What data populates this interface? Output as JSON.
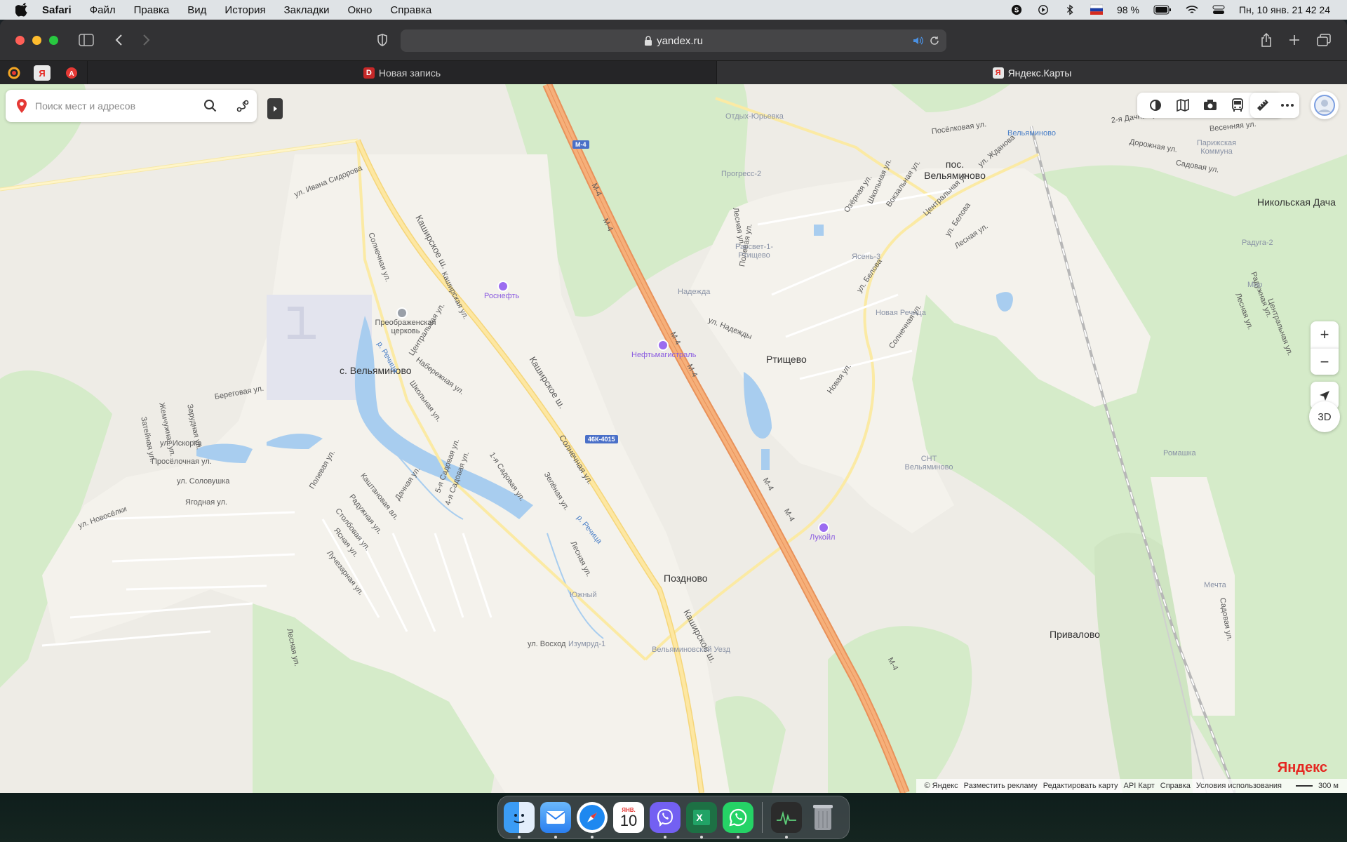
{
  "menubar": {
    "app": "Safari",
    "items": [
      "Файл",
      "Правка",
      "Вид",
      "История",
      "Закладки",
      "Окно",
      "Справка"
    ],
    "battery": "98 %",
    "datetime": "Пн, 10 янв. 21 42 24"
  },
  "browser": {
    "url": "yandex.ru",
    "tabs": [
      {
        "title": "Новая запись",
        "active": false
      },
      {
        "title": "Яндекс.Карты",
        "active": true
      }
    ]
  },
  "map": {
    "search_placeholder": "Поиск мест и адресов",
    "places": {
      "velyaminovo_village": "с. Вельяминово",
      "pos_velyaminovo": "пос. Вельяминово",
      "rtishchevo": "Ртищево",
      "pozdnovo": "Поздново",
      "privalovo": "Привалово",
      "nikolskaya_dacha": "Никольская Дача"
    },
    "pois": {
      "rosneft": "Роснефть",
      "neftemagistral": "Нефтьмагистраль",
      "lukoil": "Лукойл",
      "church": "Преображенская церковь",
      "station": "Вельяминово"
    },
    "roads": {
      "m4": "М-4",
      "kashirskoe": "Каширское ш.",
      "solnechnaya": "Солнечная ул.",
      "hw_code": "46К-4015"
    },
    "streets": {
      "ivana_sidorova": "ул. Ивана Сидорова",
      "solnechnaya_w": "Солнечная ул.",
      "kashirskaya": "Каширская ул.",
      "tsentralnaya": "Центральная ул.",
      "naberezhnaya": "Набережная ул.",
      "shkolnaya": "Школьная ул.",
      "beregovaya": "Береговая ул.",
      "zhemchuzhnaya": "Жемчужная ул.",
      "zatishnaya": "Затейная ул.",
      "zarudnaya": "Зарудная ул.",
      "iskorka": "ул. Искорка",
      "proselochnaya": "Просёлочная ул.",
      "solovushka": "ул. Соловушка",
      "yagodnaya": "Ягодная ул.",
      "novosyolki": "ул. Новосёлки",
      "polevaya_w": "Полевая ул.",
      "kashtanovaya": "Каштановая ал.",
      "raduzhnaya_w": "Радужная ул.",
      "stolbovaya": "Столбовая ул.",
      "yasnaya": "Ясная ул.",
      "luchezarnaya": "Лучезарная ул.",
      "dachnaya": "Дачная ул.",
      "sadovaya5": "5-я Садовая ул.",
      "sadovaya4": "4-я Садовая ул.",
      "sadovaya1": "1-я Садовая ул.",
      "zelenaya": "Зелёная ул.",
      "lesnaya_s": "Лесная ул.",
      "lesnaya_sw": "Лесная ул.",
      "voskhod": "ул. Восход",
      "lesnaya_n": "Лесная ул.",
      "polevaya_n": "Полевая ул.",
      "nadezhdy": "ул. Надежды",
      "novaya": "Новая ул.",
      "solnechnaya_e": "Солнечная ул.",
      "belova": "ул. Белова",
      "belova2": "ул. Белова",
      "lesnaya_e": "Лесная ул.",
      "tsentralnaya_e": "Центральная ул.",
      "vokzalnaya": "Вокзальная ул.",
      "shkolnaya_e": "Школьная ул.",
      "ozernaya": "Озёрная ул.",
      "zhdanova": "ул. Жданова",
      "poselkovaya": "Посёлковая ул.",
      "dachnaya2": "2-я Дачная ул.",
      "dorozhnaya": "Дорожная ул.",
      "vesennyaya": "Весенняя ул.",
      "sadovaya_ne": "Садовая ул.",
      "sadovaya_se": "Садовая ул.",
      "lesnaya_ne": "Лесная ул.",
      "raduzhnaya_ne": "Радужная ул.",
      "tsentralnaya_ne": "Центральная ул.",
      "parizh": "Парижская Коммуна"
    },
    "minor_labels": {
      "otdykh": "Отдых-Юрьевка",
      "progress": "Прогресс-2",
      "rassvet": "Рассвет-1-Ртищево",
      "nadezhda": "Надежда",
      "yasen": "Ясень-3",
      "novaya_rechitsa": "Новая Речица",
      "snt": "СНТ Вельяминово",
      "yuzhny": "Южный",
      "izumrud": "Изумруд-1",
      "uezd": "Вельяминовский Уезд",
      "raduga": "Радуга-2",
      "mir": "Мир",
      "romashka": "Ромашка",
      "mechta": "Мечта"
    },
    "water": {
      "rechitsa1": "р. Речица",
      "rechitsa2": "р. Речица"
    },
    "footer": [
      "© Яндекс",
      "Разместить рекламу",
      "Редактировать карту",
      "API Карт",
      "Справка",
      "Условия использования"
    ],
    "scale": "300 м",
    "logo": "Яндекс",
    "controls": {
      "zoom_in": "+",
      "zoom_out": "−",
      "mode3d": "3D"
    }
  },
  "dock": {
    "calendar_month": "ЯНВ.",
    "calendar_day": "10"
  }
}
